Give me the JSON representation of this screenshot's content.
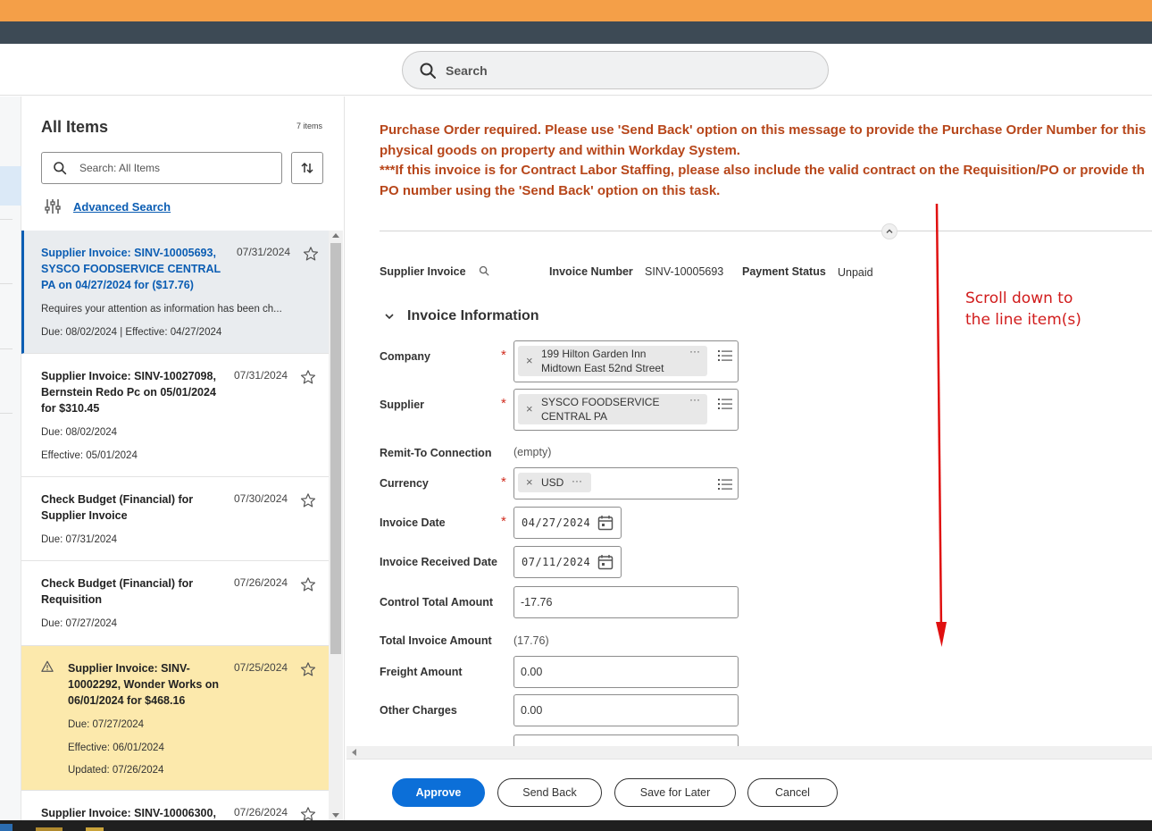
{
  "header": {
    "search_placeholder": "Search"
  },
  "list": {
    "title": "All Items",
    "count": "7 items",
    "search_placeholder": "Search: All Items",
    "advanced_search": "Advanced Search",
    "items": [
      {
        "title": "Supplier Invoice: SINV-10005693, SYSCO FOODSERVICE CENTRAL PA on 04/27/2024 for ($17.76)",
        "date": "07/31/2024",
        "note": "Requires your attention as information has been ch...",
        "line1": "Due: 08/02/2024 | Effective: 04/27/2024"
      },
      {
        "title": "Supplier Invoice: SINV-10027098, Bernstein Redo Pc on 05/01/2024 for $310.45",
        "date": "07/31/2024",
        "line1": "Due: 08/02/2024",
        "line2": "Effective: 05/01/2024"
      },
      {
        "title": "Check Budget (Financial) for Supplier Invoice",
        "date": "07/30/2024",
        "line1": "Due: 07/31/2024"
      },
      {
        "title": "Check Budget (Financial) for Requisition",
        "date": "07/26/2024",
        "line1": "Due: 07/27/2024"
      },
      {
        "title": "Supplier Invoice: SINV-10002292, Wonder Works on 06/01/2024 for $468.16",
        "date": "07/25/2024",
        "line1": "Due: 07/27/2024",
        "line2": "Effective: 06/01/2024",
        "line3": "Updated: 07/26/2024"
      },
      {
        "title": "Supplier Invoice: SINV-10006300,",
        "date": "07/26/2024"
      }
    ]
  },
  "main": {
    "alert_lines": [
      "Purchase Order required. Please use 'Send Back' option on this message to provide the Purchase Order Number for this",
      "physical goods on property and within Workday System.",
      "***If this invoice is for Contract Labor Staffing, please also include the valid contract on the Requisition/PO or provide th",
      "PO number using the 'Send Back' option on this task."
    ],
    "meta": {
      "supplier_invoice_label": "Supplier Invoice",
      "invoice_number_label": "Invoice Number",
      "invoice_number": "SINV-10005693",
      "payment_status_label": "Payment Status",
      "payment_status": "Unpaid"
    },
    "section_title": "Invoice Information",
    "fields": {
      "company_label": "Company",
      "company_value_1": "199 Hilton Garden Inn",
      "company_value_2": "Midtown East 52nd Street",
      "supplier_label": "Supplier",
      "supplier_value_1": "SYSCO FOODSERVICE",
      "supplier_value_2": "CENTRAL PA",
      "remit_label": "Remit-To Connection",
      "remit_value": "(empty)",
      "currency_label": "Currency",
      "currency_value": "USD",
      "invoice_date_label": "Invoice Date",
      "invoice_date": "04/27/2024",
      "received_date_label": "Invoice Received Date",
      "received_date": "07/11/2024",
      "control_total_label": "Control Total Amount",
      "control_total": "-17.76",
      "total_invoice_label": "Total Invoice Amount",
      "total_invoice": "(17.76)",
      "freight_label": "Freight Amount",
      "freight": "0.00",
      "other_charges_label": "Other Charges",
      "other_charges": "0.00"
    },
    "annotation_line1": "Scroll down to",
    "annotation_line2": "the line item(s)"
  },
  "footer": {
    "approve": "Approve",
    "send_back": "Send Back",
    "save_later": "Save for Later",
    "cancel": "Cancel"
  },
  "colors": {
    "accent": "#0c6fd8",
    "alert": "#b7461a",
    "annotation": "#d11c1c",
    "top_bar": "#f49f48"
  }
}
